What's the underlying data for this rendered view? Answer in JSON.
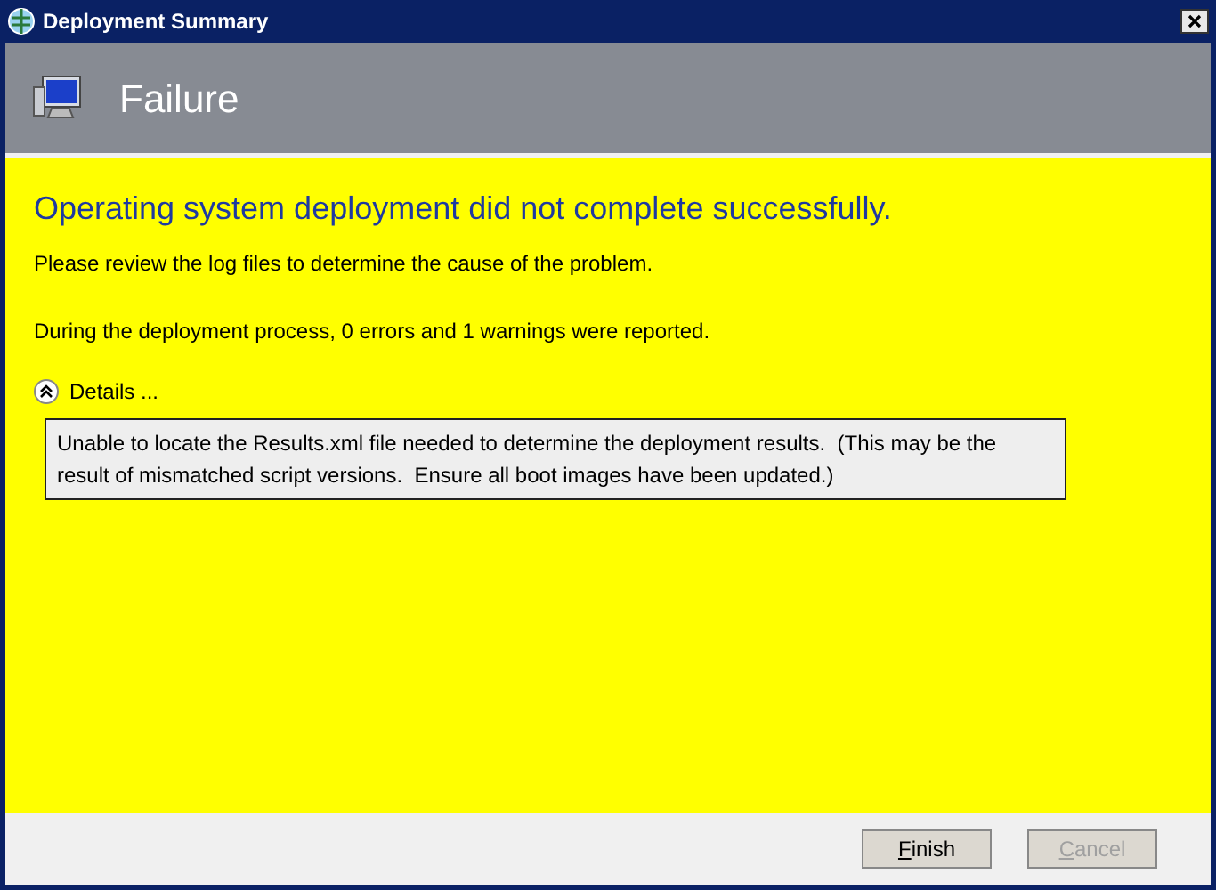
{
  "window": {
    "title": "Deployment Summary"
  },
  "header": {
    "title": "Failure"
  },
  "body": {
    "heading": "Operating system deployment did not complete successfully.",
    "message": "Please review the log files to determine the cause of the problem.",
    "summary": "During the deployment process, 0 errors and 1 warnings were reported.",
    "details": {
      "label": "Details ...",
      "expanded": true,
      "text": "Unable to locate the Results.xml file needed to determine the deployment results.  (This may be the result of mismatched script versions.  Ensure all boot images have been updated.)"
    }
  },
  "buttons": [
    {
      "label": "Finish",
      "disabled": false
    },
    {
      "label": "Cancel",
      "disabled": true
    }
  ]
}
